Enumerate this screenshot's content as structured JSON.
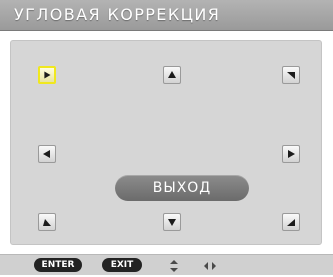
{
  "window": {
    "title": "УГЛОВАЯ КОРРЕКЦИЯ"
  },
  "corner_controls": [
    {
      "name": "top-left-corner-button",
      "icon": "arrow-down-right-icon",
      "selected": true
    },
    {
      "name": "top-center-button",
      "icon": "arrow-up-icon",
      "selected": false
    },
    {
      "name": "top-right-corner-button",
      "icon": "arrow-down-left-icon",
      "selected": false
    },
    {
      "name": "middle-left-button",
      "icon": "arrow-left-icon",
      "selected": false
    },
    {
      "name": "middle-right-button",
      "icon": "arrow-right-icon",
      "selected": false
    },
    {
      "name": "bottom-left-corner-button",
      "icon": "arrow-up-right-icon",
      "selected": false
    },
    {
      "name": "bottom-center-button",
      "icon": "arrow-down-icon",
      "selected": false
    },
    {
      "name": "bottom-right-corner-button",
      "icon": "arrow-up-left-icon",
      "selected": false
    }
  ],
  "exit_button": {
    "label": "ВЫХОД"
  },
  "hints": [
    {
      "label": "ENTER"
    },
    {
      "label": "EXIT"
    },
    {
      "icon": "up-down-arrows-icon"
    },
    {
      "icon": "left-right-arrows-icon"
    }
  ],
  "colors": {
    "selection": "#f0e81e",
    "title_bar": "#a8a8a8",
    "panel": "#d6d6d6",
    "exit_button": "#7a7a7a",
    "hint_pill": "#232323"
  }
}
